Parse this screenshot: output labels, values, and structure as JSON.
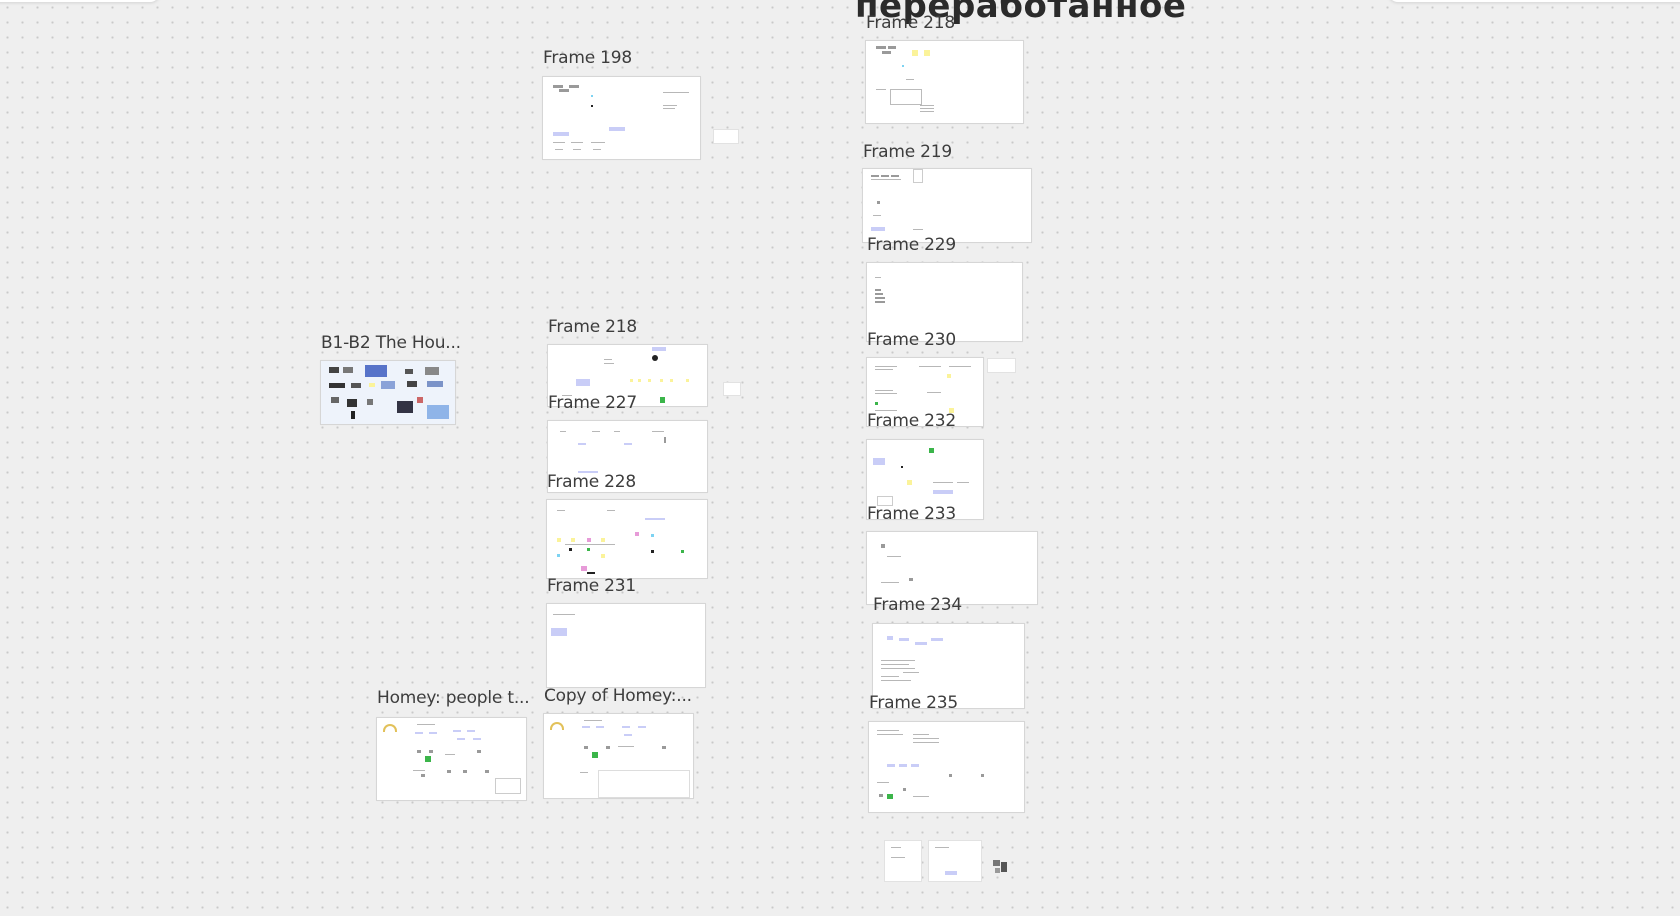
{
  "board": {
    "title": "переработанное"
  },
  "frames": [
    {
      "id": "f198",
      "label": "Frame 198"
    },
    {
      "id": "f218a",
      "label": "Frame 218"
    },
    {
      "id": "f219",
      "label": "Frame 219"
    },
    {
      "id": "f229",
      "label": "Frame 229"
    },
    {
      "id": "f230",
      "label": "Frame 230"
    },
    {
      "id": "f232",
      "label": "Frame 232"
    },
    {
      "id": "f233",
      "label": "Frame 233"
    },
    {
      "id": "f234",
      "label": "Frame 234"
    },
    {
      "id": "f235",
      "label": "Frame 235"
    },
    {
      "id": "f218b",
      "label": "Frame 218"
    },
    {
      "id": "f227",
      "label": "Frame 227"
    },
    {
      "id": "f228",
      "label": "Frame 228"
    },
    {
      "id": "f231",
      "label": "Frame 231"
    },
    {
      "id": "b1b2",
      "label": "B1-B2 The Hou..."
    },
    {
      "id": "homey",
      "label": "Homey: people t..."
    },
    {
      "id": "homeycopy",
      "label": "Copy of Homey:..."
    }
  ],
  "colors": {
    "canvas": "#efefef",
    "frame_bg": "#ffffff",
    "label": "#3d3d3d",
    "accent_blue": "#c9cdf7",
    "sticky_yellow": "#fbf39a",
    "green": "#3bb54a"
  }
}
